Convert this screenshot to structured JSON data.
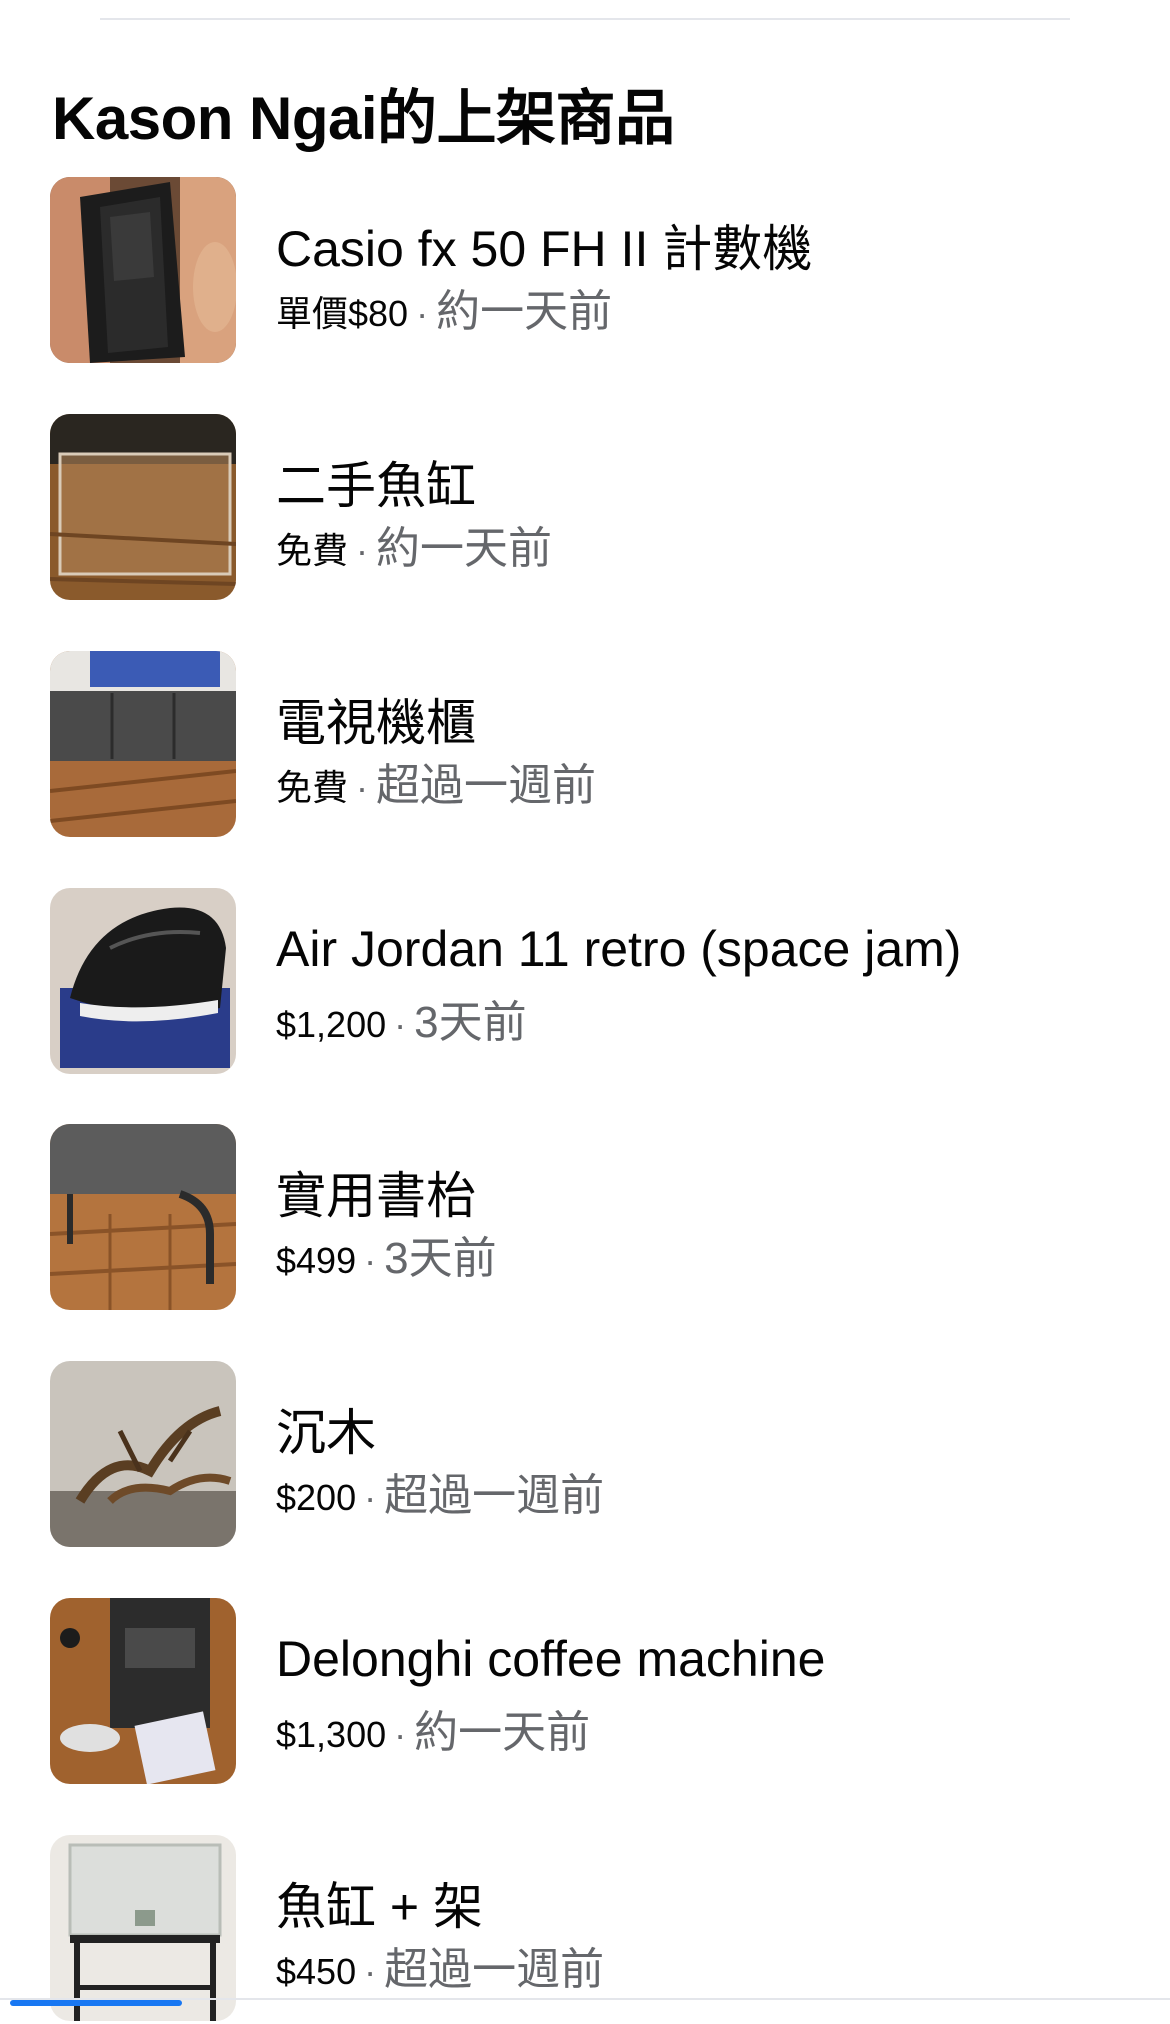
{
  "header": {
    "title": "Kason Ngai的上架商品"
  },
  "listings": [
    {
      "title": "Casio fx 50 FH II 計數機",
      "price": "單價$80",
      "time": "約一天前",
      "image": "calculator-photo"
    },
    {
      "title": "二手魚缸",
      "price": "免費",
      "time": "約一天前",
      "image": "fish-tank-photo"
    },
    {
      "title": "電視機櫃",
      "price": "免費",
      "time": "超過一週前",
      "image": "tv-cabinet-photo"
    },
    {
      "title": "Air Jordan 11 retro (space jam)",
      "price": "$1,200",
      "time": "3天前",
      "image": "sneaker-photo"
    },
    {
      "title": "實用書枱",
      "price": "$499",
      "time": "3天前",
      "image": "desk-photo"
    },
    {
      "title": "沉木",
      "price": "$200",
      "time": "超過一週前",
      "image": "driftwood-photo"
    },
    {
      "title": "Delonghi coffee machine",
      "price": "$1,300",
      "time": "約一天前",
      "image": "coffee-machine-photo"
    },
    {
      "title": "魚缸 + 架",
      "price": "$450",
      "time": "超過一週前",
      "image": "tank-stand-photo"
    }
  ],
  "separator": "·",
  "colors": {
    "accent": "#1877f2",
    "secondary_text": "#65676b",
    "divider": "#e4e6eb"
  }
}
